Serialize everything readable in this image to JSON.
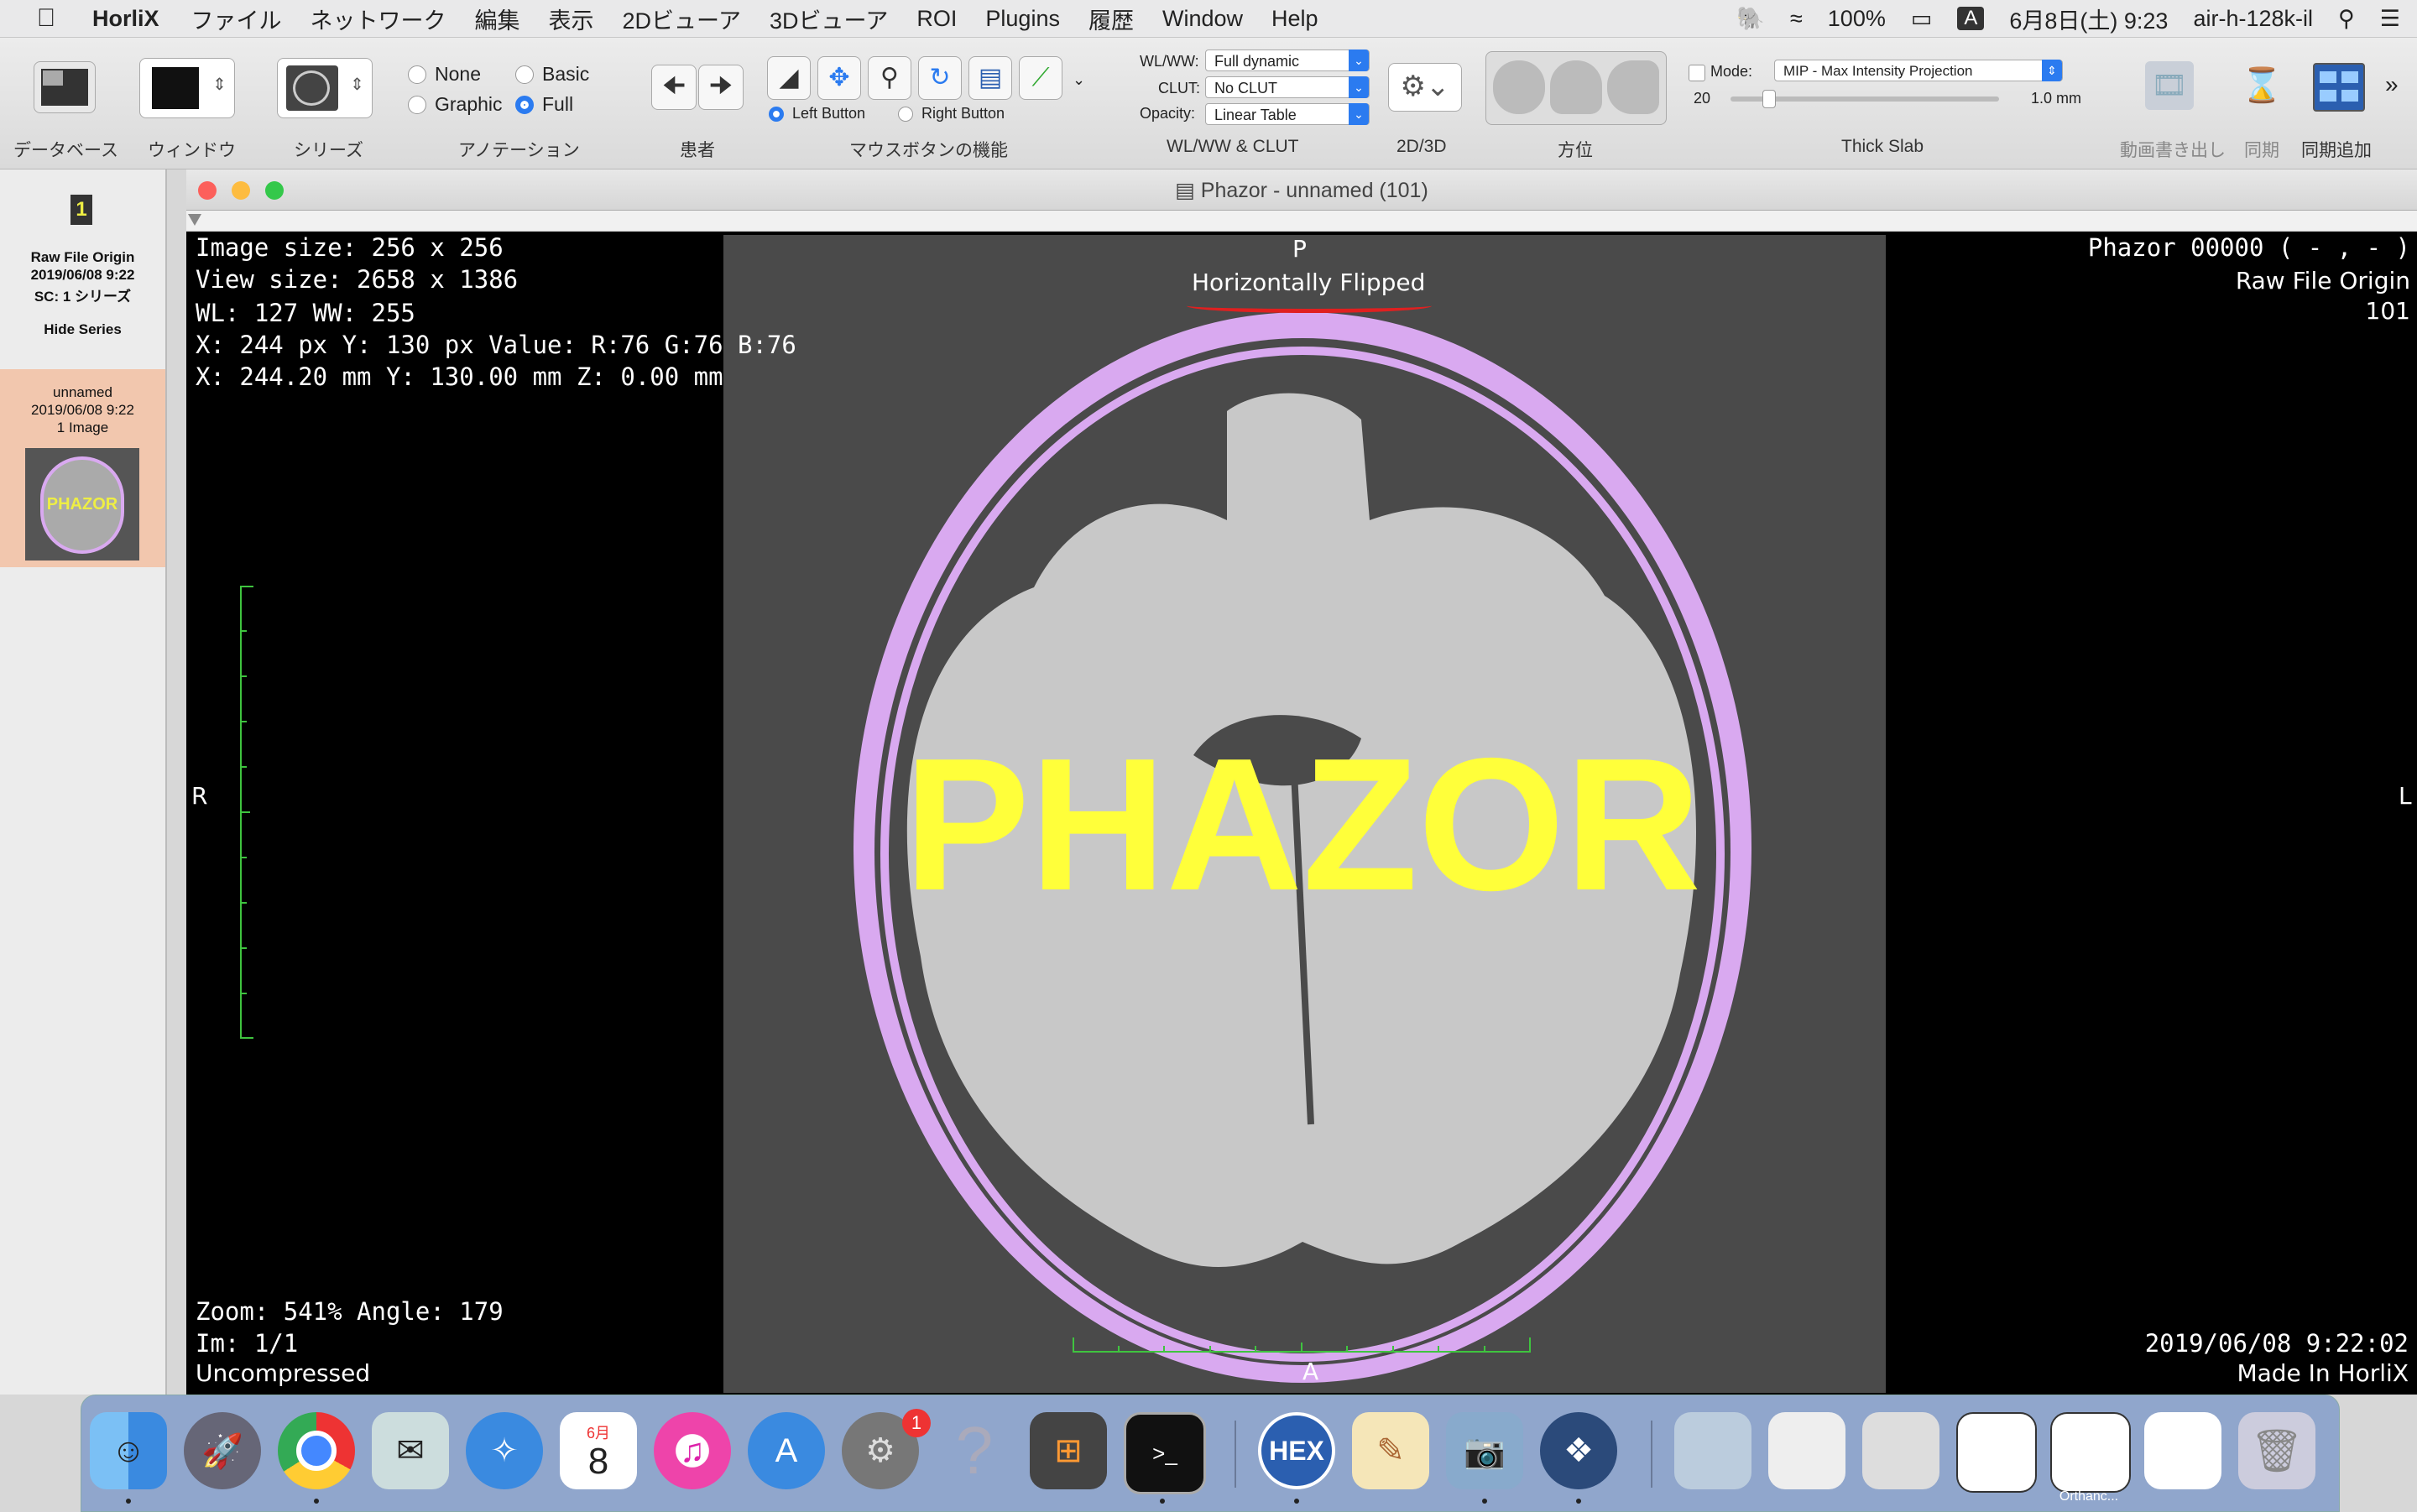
{
  "menubar": {
    "app": "HorliX",
    "menus": [
      "ファイル",
      "ネットワーク",
      "編集",
      "表示",
      "2Dビューア",
      "3Dビューア",
      "ROI",
      "Plugins",
      "履歴",
      "Window",
      "Help"
    ],
    "battery": "100%",
    "ime": "A",
    "datetime": "6月8日(土) 9:23",
    "user": "air-h-128k-il"
  },
  "toolbar": {
    "labels": {
      "database": "データベース",
      "window": "ウィンドウ",
      "series": "シリーズ",
      "annotation": "アノテーション",
      "patient": "患者",
      "mouse": "マウスボタンの機能",
      "wlww_clut": "WL/WW & CLUT",
      "twod3d": "2D/3D",
      "orientation": "方位",
      "thickslab": "Thick Slab",
      "movie": "動画書き出し",
      "sync": "同期",
      "sync_add": "同期追加"
    },
    "annotation_opts": [
      "None",
      "Basic",
      "Graphic",
      "Full"
    ],
    "annotation_selected": "Full",
    "mouse_buttons": [
      "Left Button",
      "Right Button"
    ],
    "mouse_selected": "Left Button",
    "wlww_label": "WL/WW:",
    "wlww_value": "Full dynamic",
    "clut_label": "CLUT:",
    "clut_value": "No CLUT",
    "opacity_label": "Opacity:",
    "opacity_value": "Linear Table",
    "mode_label": "Mode:",
    "mode_value": "MIP - Max Intensity Projection",
    "slab_count": "20",
    "slab_thickness": "1.0 mm"
  },
  "sidebar": {
    "study_badge": "1",
    "study_title": "Raw File Origin",
    "study_date": "2019/06/08 9:22",
    "study_sc": "SC: 1 シリーズ",
    "hide_series": "Hide Series",
    "series_name": "unnamed",
    "series_date": "2019/06/08 9:22",
    "series_count": "1 Image",
    "thumb_text": "PHAZOR"
  },
  "window": {
    "title": "Phazor - unnamed (101)"
  },
  "overlay": {
    "image_size": "Image size: 256 x 256",
    "view_size": "View size: 2658 x 1386",
    "wl_ww": "WL: 127 WW: 255",
    "pixel": "X: 244 px Y: 130 px Value: R:76 G:76 B:76",
    "mm": "X: 244.20 mm Y: 130.00 mm Z: 0.00 mm",
    "top_orient": "P",
    "flip_note": "Horizontally Flipped",
    "right_top_1": "Phazor 00000 ( - , - )",
    "right_top_2": "Raw File Origin",
    "right_top_3": "101",
    "left_orient": "R",
    "right_orient": "L",
    "bottom_orient": "A",
    "zoom": "Zoom: 541% Angle: 179",
    "im": "Im: 1/1",
    "compression": "Uncompressed",
    "datetime": "2019/06/08 9:22:02",
    "made_in": "Made In HorliX",
    "watermark": "PHAZOR"
  },
  "dock": {
    "calendar_month": "6月",
    "calendar_day": "8",
    "badge": "1",
    "hex_label": "HEX",
    "orthanc_label": "Orthanc..."
  },
  "colors": {
    "bone": "#d9a9f0",
    "brain": "#c8c8c8",
    "background": "#4a4a4a",
    "watermark": "#ffff3a",
    "ruler": "#3fc43f",
    "annotation_line": "#e02020"
  }
}
